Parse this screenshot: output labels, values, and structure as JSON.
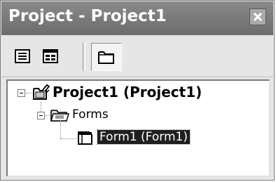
{
  "window": {
    "title": "Project - Project1",
    "close_icon": "close-icon"
  },
  "toolbar": {
    "buttons": [
      {
        "name": "view-code-button",
        "icon": "view-code-icon"
      },
      {
        "name": "view-object-button",
        "icon": "view-object-icon"
      },
      {
        "name": "toggle-folders-button",
        "icon": "folder-icon",
        "pressed": true
      }
    ]
  },
  "tree": {
    "root": {
      "label": "Project1 (Project1)",
      "icon": "project-icon",
      "expanded": true
    },
    "folder": {
      "label": "Forms",
      "icon": "forms-folder-icon",
      "expanded": true
    },
    "item": {
      "label": "Form1 (Form1)",
      "icon": "form-icon",
      "selected": true
    }
  },
  "colors": {
    "title_bar": "#7a7a7a",
    "selection": "#1f1f1f",
    "panel": "#e6e6e6"
  }
}
